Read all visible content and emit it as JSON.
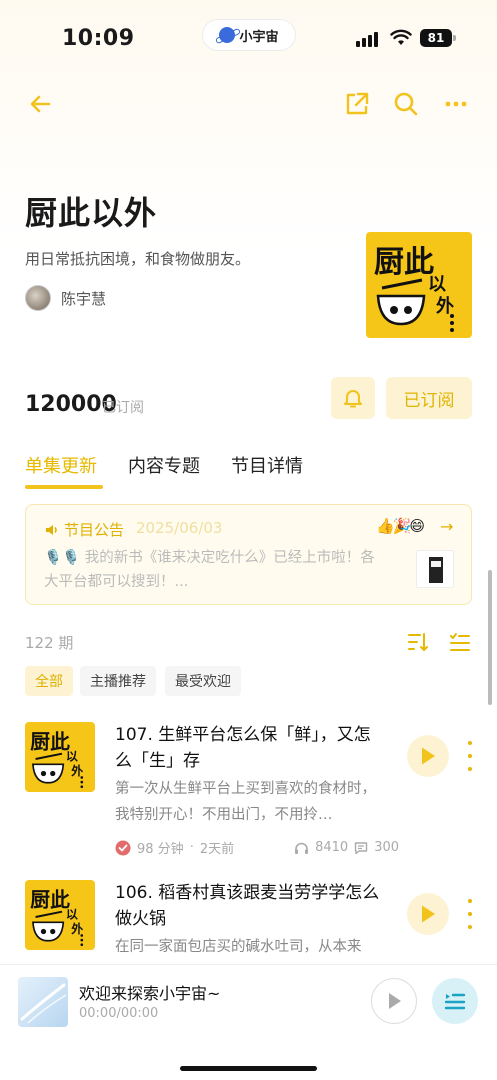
{
  "status_bar": {
    "time": "10:09",
    "app_pill": "小宇宙",
    "battery": "81"
  },
  "nav": {
    "back_icon": "back-arrow-icon",
    "share_icon": "share-icon",
    "search_icon": "search-icon",
    "more_icon": "more-icon"
  },
  "podcast": {
    "title": "厨此以外",
    "description": "用日常抵抗困境，和食物做朋友。",
    "author": "陈宇慧",
    "cover_text": "厨此以外",
    "subscriber_count": "120000",
    "subscriber_label": "已订阅",
    "subscribe_button": "已订阅"
  },
  "tabs": [
    {
      "label": "单集更新",
      "active": true
    },
    {
      "label": "内容专题",
      "active": false
    },
    {
      "label": "节目详情",
      "active": false
    }
  ],
  "announcement": {
    "label": "节目公告",
    "date": "2025/06/03",
    "emojis": "👍🎉😄",
    "mics": "🎙️🎙️",
    "text": "我的新书《谁来决定吃什么》已经上市啦！各大平台都可以搜到！..."
  },
  "episode_list": {
    "count": "122 期",
    "filters": [
      {
        "label": "全部",
        "active": true
      },
      {
        "label": "主播推荐",
        "active": false
      },
      {
        "label": "最受欢迎",
        "active": false
      }
    ],
    "episodes": [
      {
        "title": "107. 生鲜平台怎么保「鲜」，又怎么「生」存",
        "description": "第一次从生鲜平台上买到喜欢的食材时，我特别开心！不用出门，不用拎…",
        "duration": "98 分钟",
        "age": "2天前",
        "plays": "8410",
        "comments": "300"
      },
      {
        "title": "106. 稻香村真该跟麦当劳学学怎么做火锅",
        "description": "在同一家面包店买的碱水吐司，从本来"
      }
    ]
  },
  "player": {
    "title": "欢迎来探索小宇宙~",
    "time": "00:00/00:00"
  },
  "colors": {
    "accent": "#f2c21d",
    "accent_light": "#fdf3d3",
    "cover_bg": "#f5c518"
  }
}
